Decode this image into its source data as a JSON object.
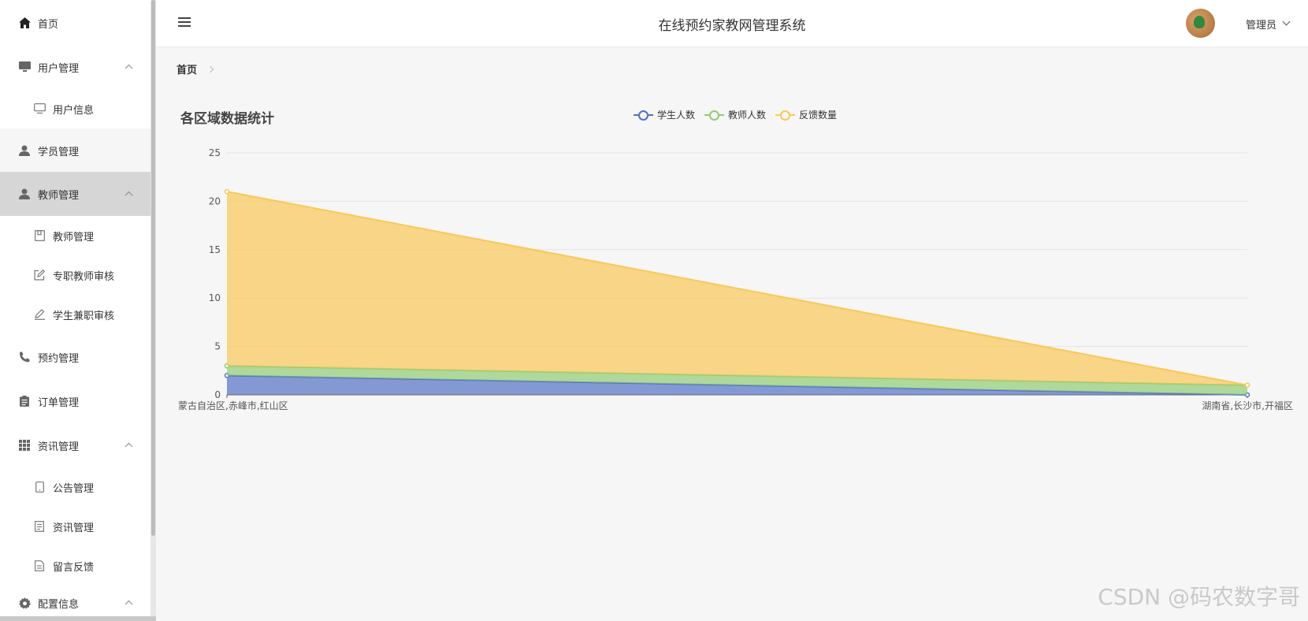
{
  "header": {
    "title": "在线预约家教网管理系统",
    "user_name": "管理员"
  },
  "breadcrumb": {
    "home": "首页"
  },
  "sidebar": {
    "items": [
      {
        "label": "首页",
        "icon": "home-icon"
      },
      {
        "label": "用户管理",
        "icon": "monitor-icon"
      },
      {
        "label": "用户信息",
        "icon": "monitor-outline-icon"
      },
      {
        "label": "学员管理",
        "icon": "user-icon"
      },
      {
        "label": "教师管理",
        "icon": "user-icon"
      },
      {
        "label": "教师管理",
        "icon": "notebook-icon"
      },
      {
        "label": "专职教师审核",
        "icon": "edit-icon"
      },
      {
        "label": "学生兼职审核",
        "icon": "pen-icon"
      },
      {
        "label": "预约管理",
        "icon": "phone-icon"
      },
      {
        "label": "订单管理",
        "icon": "clipboard-icon"
      },
      {
        "label": "资讯管理",
        "icon": "grid-icon"
      },
      {
        "label": "公告管理",
        "icon": "tablet-icon"
      },
      {
        "label": "资讯管理",
        "icon": "document-icon"
      },
      {
        "label": "留言反馈",
        "icon": "document-icon"
      },
      {
        "label": "配置信息",
        "icon": "gear-icon"
      }
    ]
  },
  "chart_data": {
    "type": "area",
    "title": "各区域数据统计",
    "categories": [
      "内蒙古自治区,赤峰市,红山区",
      "湖南省,长沙市,开福区"
    ],
    "category_labels_visible": [
      "蒙古自治区,赤峰市,红山区",
      "湖南省,长沙市,开福区"
    ],
    "series": [
      {
        "name": "学生人数",
        "values": [
          2,
          0
        ],
        "color": "#5470c6"
      },
      {
        "name": "教师人数",
        "values": [
          1,
          1
        ],
        "color": "#91cc75"
      },
      {
        "name": "反馈数量",
        "values": [
          18,
          0
        ],
        "color": "#fac858"
      }
    ],
    "stacked": true,
    "ylim": [
      0,
      25
    ],
    "yticks": [
      "0",
      "5",
      "10",
      "15",
      "20",
      "25"
    ],
    "grid": "horizontal",
    "legend": "top-center"
  },
  "watermark": "CSDN @码农数字哥"
}
